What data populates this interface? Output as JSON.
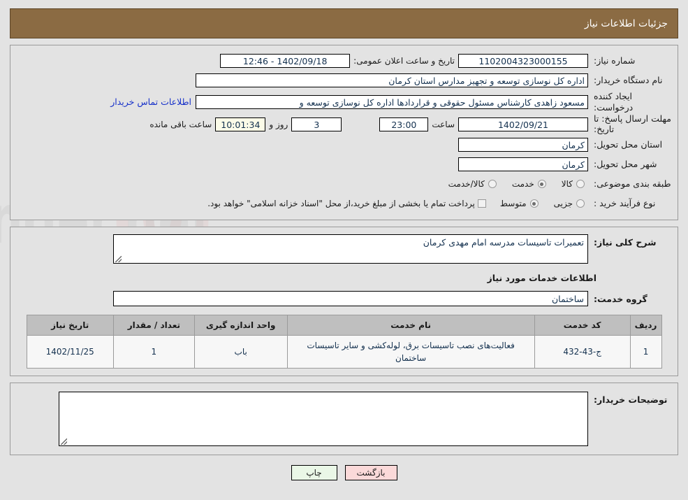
{
  "header": {
    "title": "جزئیات اطلاعات نیاز"
  },
  "top_form": {
    "need_number_label": "شماره نیاز:",
    "need_number_value": "1102004323000155",
    "announce_label": "تاریخ و ساعت اعلان عمومی:",
    "announce_value": "1402/09/18 - 12:46",
    "buyer_org_label": "نام دستگاه خریدار:",
    "buyer_org_value": "اداره کل نوسازی  توسعه و تجهیز مدارس استان کرمان",
    "requester_label": "ایجاد کننده درخواست:",
    "requester_value": "مسعود زاهدی کارشناس مسئول حقوقی و قراردادها اداره کل نوسازی  توسعه و",
    "contact_link": "اطلاعات تماس خریدار",
    "deadline_label": "مهلت ارسال پاسخ: تا تاریخ:",
    "deadline_date": "1402/09/21",
    "hour_word": "ساعت",
    "deadline_hour": "23:00",
    "remaining_days": "3",
    "days_and_word": "روز و",
    "remaining_clock": "10:01:34",
    "remaining_suffix": "ساعت باقی مانده",
    "province_label": "استان محل تحویل:",
    "province_value": "کرمان",
    "city_label": "شهر محل تحویل:",
    "city_value": "کرمان",
    "category_label": "طبقه بندی موضوعی:",
    "category_options": [
      {
        "label": "کالا",
        "selected": false
      },
      {
        "label": "خدمت",
        "selected": true
      },
      {
        "label": "کالا/خدمت",
        "selected": false
      }
    ],
    "process_label": "نوع فرآیند خرید :",
    "process_options": [
      {
        "label": "جزیی",
        "selected": false
      },
      {
        "label": "متوسط",
        "selected": true
      }
    ],
    "treasury_note": "پرداخت تمام یا بخشی از مبلغ خرید،از محل \"اسناد خزانه اسلامی\" خواهد بود."
  },
  "middle": {
    "summary_label": "شرح کلی نیاز:",
    "summary_value": "تعمیرات تاسیسات مدرسه امام مهدی کرمان",
    "section_title": "اطلاعات خدمات مورد نیاز",
    "service_group_label": "گروه خدمت:",
    "service_group_value": "ساختمان",
    "table": {
      "headers": [
        "ردیف",
        "کد خدمت",
        "نام خدمت",
        "واحد اندازه گیری",
        "تعداد / مقدار",
        "تاریخ نیاز"
      ],
      "rows": [
        {
          "radif": "1",
          "code": "ج-43-432",
          "name": "فعالیت‌های نصب تاسیسات برق، لوله‌کشی و سایر تاسیسات ساختمان",
          "unit": "باب",
          "qty": "1",
          "date": "1402/11/25"
        }
      ]
    }
  },
  "bottom": {
    "buyer_notes_label": "توضیحات خریدار:",
    "buyer_notes_value": ""
  },
  "buttons": {
    "back": "بازگشت",
    "print": "چاپ"
  },
  "colors": {
    "header_bg": "#8b6b43",
    "page_bg": "#e3e3e3",
    "link": "#1630c9",
    "back_btn": "#fbd9d9",
    "print_btn": "#eaf7e7",
    "table_header": "#bfbfbf"
  },
  "watermark": {
    "text": "AriaTender.net"
  }
}
